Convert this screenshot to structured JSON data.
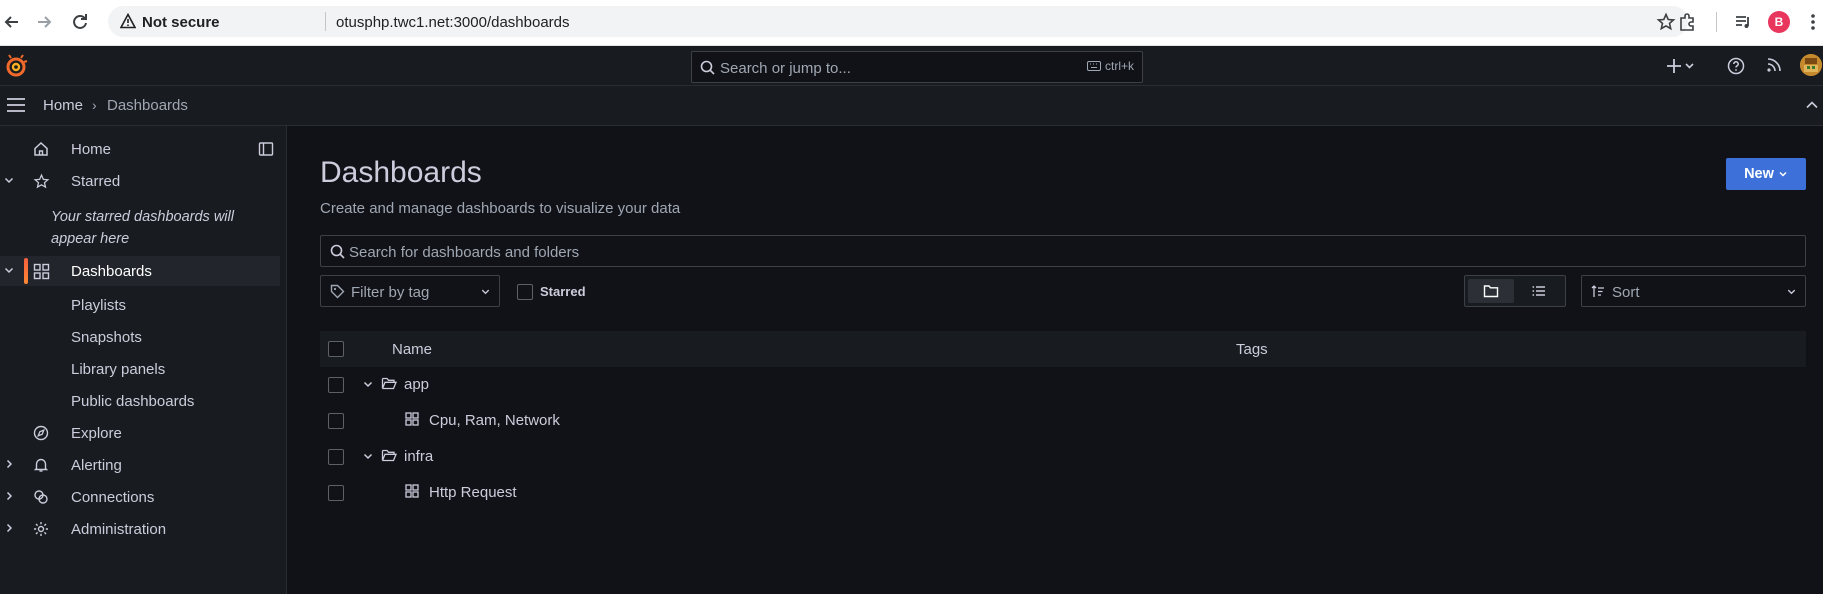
{
  "browser": {
    "security_label": "Not secure",
    "url": "otusphp.twc1.net:3000/dashboards",
    "profile_initial": "B"
  },
  "topbar": {
    "search_placeholder": "Search or jump to...",
    "shortcut": "ctrl+k"
  },
  "breadcrumb": {
    "home": "Home",
    "separator": "›",
    "current": "Dashboards"
  },
  "sidebar": {
    "home": "Home",
    "starred": "Starred",
    "starred_empty": "Your starred dashboards will appear here",
    "dashboards": "Dashboards",
    "sub_items": [
      "Playlists",
      "Snapshots",
      "Library panels",
      "Public dashboards"
    ],
    "explore": "Explore",
    "alerting": "Alerting",
    "connections": "Connections",
    "administration": "Administration"
  },
  "main": {
    "title": "Dashboards",
    "subtitle": "Create and manage dashboards to visualize your data",
    "new_button": "New",
    "search_placeholder": "Search for dashboards and folders",
    "tag_filter_placeholder": "Filter by tag",
    "starred_label": "Starred",
    "sort_placeholder": "Sort",
    "columns": {
      "name": "Name",
      "tags": "Tags"
    },
    "rows": [
      {
        "type": "folder",
        "name": "app"
      },
      {
        "type": "dashboard",
        "name": "Cpu, Ram, Network"
      },
      {
        "type": "folder",
        "name": "infra"
      },
      {
        "type": "dashboard",
        "name": "Http Request"
      }
    ]
  },
  "colors": {
    "accent": "#3d71d9",
    "active_bar": "#f55f3e",
    "background": "#111217",
    "panel": "#181b1f"
  }
}
